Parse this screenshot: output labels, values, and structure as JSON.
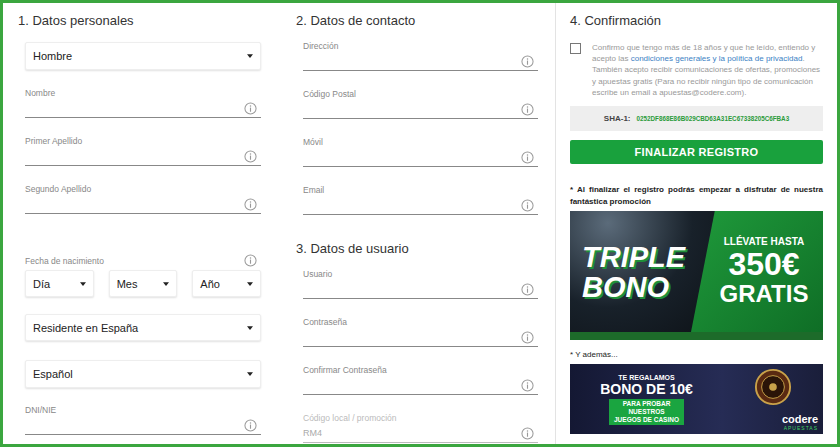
{
  "personal": {
    "title": "1. Datos personales",
    "gender": "Hombre",
    "fields": [
      "Nombre",
      "Primer Apellido",
      "Segundo Apellido"
    ],
    "birth": {
      "label": "Fecha de nacimiento",
      "selects": [
        "Día",
        "Mes",
        "Año"
      ]
    },
    "residence": "Residente en España",
    "language": "Español",
    "document": "DNI/NIE"
  },
  "contact": {
    "title": "2. Datos de contacto",
    "fields": [
      "Dirección",
      "Código Postal",
      "Móvil",
      "Email"
    ]
  },
  "user": {
    "title": "3. Datos de usuario",
    "fields": [
      {
        "label": "Usuario",
        "disabled": false
      },
      {
        "label": "Contraseña",
        "disabled": false
      },
      {
        "label": "Confirmar Contraseña",
        "disabled": false
      },
      {
        "label": "Código local / promoción",
        "value": "RM4",
        "disabled": true
      }
    ]
  },
  "confirmation": {
    "title": "4. Confirmación",
    "checked": false,
    "consent": [
      {
        "text": "Confirmo que tengo más de 18 años y que he leído, entiendo y acepto las ",
        "link": false
      },
      {
        "text": "condiciones generales y la política de privacidad",
        "link": true
      },
      {
        "text": ". También acepto recibir comunicaciones de ofertas, promociones y apuestas gratis (Para no recibir ningún tipo de comunicación escribe un email a apuestas@codere.com).",
        "link": false
      }
    ],
    "sha": {
      "label": "SHA-1:",
      "value": "0252DF868E86B029CBD63A31EC67338205C6FBA3"
    },
    "button": "FINALIZAR REGISTRO",
    "note": "* Al finalizar el registro podrás empezar a disfrutar de nuestra fantástica promoción",
    "banner1": {
      "left": [
        "TRIPLE",
        "BONO"
      ],
      "kicker": "LLÉVATE HASTA",
      "amount": "350€",
      "free": "GRATIS"
    },
    "more": "* Y además...",
    "banner2": {
      "kicker": "TE REGALAMOS",
      "headline": "BONO DE 10€",
      "sub": [
        "PARA PROBAR",
        "NUESTROS",
        "JUEGOS DE CASINO"
      ],
      "brand": "codere",
      "brandSub": "APUESTAS"
    }
  }
}
